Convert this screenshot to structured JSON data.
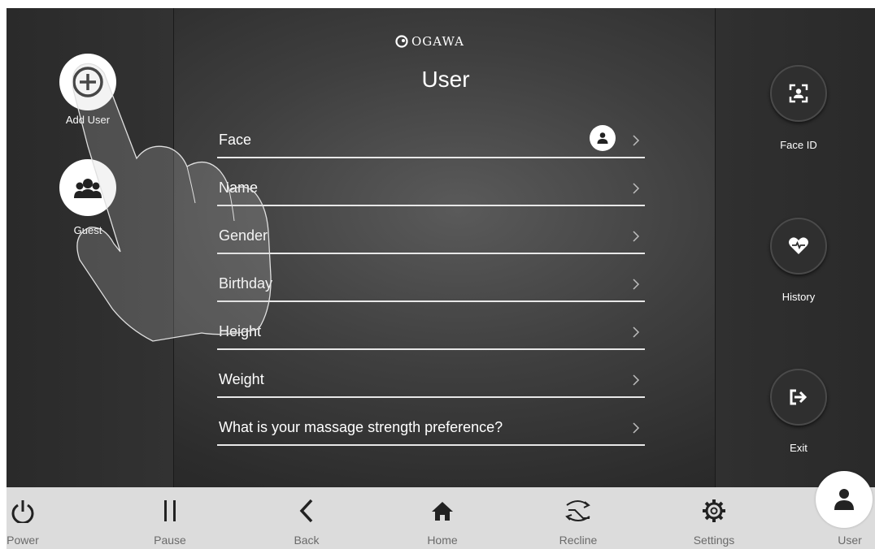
{
  "brand": {
    "name": "OGAWA"
  },
  "page": {
    "title": "User"
  },
  "left": {
    "add_user_label": "Add User",
    "guest_label": "Guest"
  },
  "menu": [
    {
      "label": "Face",
      "has_avatar": true
    },
    {
      "label": "Name"
    },
    {
      "label": "Gender"
    },
    {
      "label": "Birthday"
    },
    {
      "label": "Height"
    },
    {
      "label": "Weight"
    },
    {
      "label": "What is your massage strength preference?"
    }
  ],
  "right": {
    "face_id_label": "Face ID",
    "history_label": "History",
    "exit_label": "Exit"
  },
  "nav": {
    "power": "Power",
    "pause": "Pause",
    "back": "Back",
    "home": "Home",
    "recline": "Recline",
    "settings": "Settings",
    "user": "User"
  },
  "icons": [
    "plus-icon",
    "guest-group-icon",
    "face-scan-icon",
    "heart-pulse-icon",
    "exit-icon",
    "power-icon",
    "pause-icon",
    "back-icon",
    "home-icon",
    "recline-icon",
    "gear-icon",
    "user-icon",
    "chevron-right-icon",
    "hand-pointer-icon"
  ],
  "colors": {
    "background": "#3f3f3f",
    "text": "#ffffff",
    "bottom_bar": "#dcdcdc",
    "bottom_label": "#6a6a6a"
  }
}
